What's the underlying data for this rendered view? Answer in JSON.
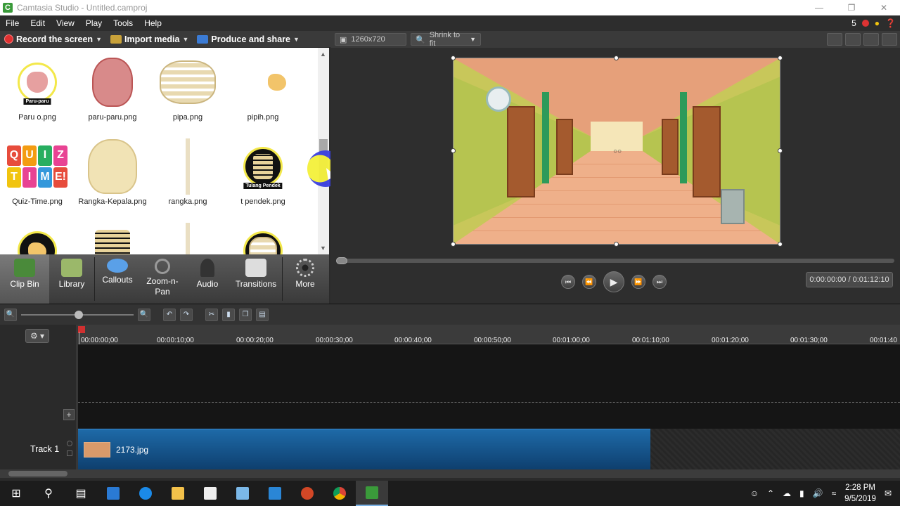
{
  "window": {
    "title": "Camtasia Studio - Untitled.camproj",
    "app_icon": "C"
  },
  "menu": {
    "items": [
      "File",
      "Edit",
      "View",
      "Play",
      "Tools",
      "Help"
    ],
    "notif_count": "5"
  },
  "tasks": {
    "record": "Record the screen",
    "import": "Import media",
    "produce": "Produce and share"
  },
  "clips": [
    {
      "label": "Paru o.png",
      "tag": "Paru-paru"
    },
    {
      "label": "paru-paru.png"
    },
    {
      "label": "pipa.png"
    },
    {
      "label": "pipih.png"
    },
    {
      "label": "Quiz-Time.png"
    },
    {
      "label": "Rangka-Kepala.png"
    },
    {
      "label": "rangka.png"
    },
    {
      "label": "t pendek.png",
      "tag": "Tulang Pendek"
    }
  ],
  "quiz_letters": [
    "Q",
    "U",
    "I",
    "Z",
    "T",
    "I",
    "M",
    "E!"
  ],
  "tools": {
    "clip_bin": "Clip Bin",
    "library": "Library",
    "callouts": "Callouts",
    "zoom": "Zoom-n-Pan",
    "audio": "Audio",
    "transitions": "Transitions",
    "more": "More"
  },
  "preview": {
    "resolution": "1260x720",
    "zoom": "Shrink to fit",
    "timecode": "0:00:00:00 / 0:01:12:10"
  },
  "timeline": {
    "ticks": [
      "00:00:00;00",
      "00:00:10;00",
      "00:00:20;00",
      "00:00:30;00",
      "00:00:40;00",
      "00:00:50;00",
      "00:01:00;00",
      "00:01:10;00",
      "00:01:20;00",
      "00:01:30;00",
      "00:01:40"
    ],
    "track_label": "Track 1",
    "clip_name": "2173.jpg"
  },
  "taskbar": {
    "time": "2:28 PM",
    "date": "9/5/2019"
  }
}
